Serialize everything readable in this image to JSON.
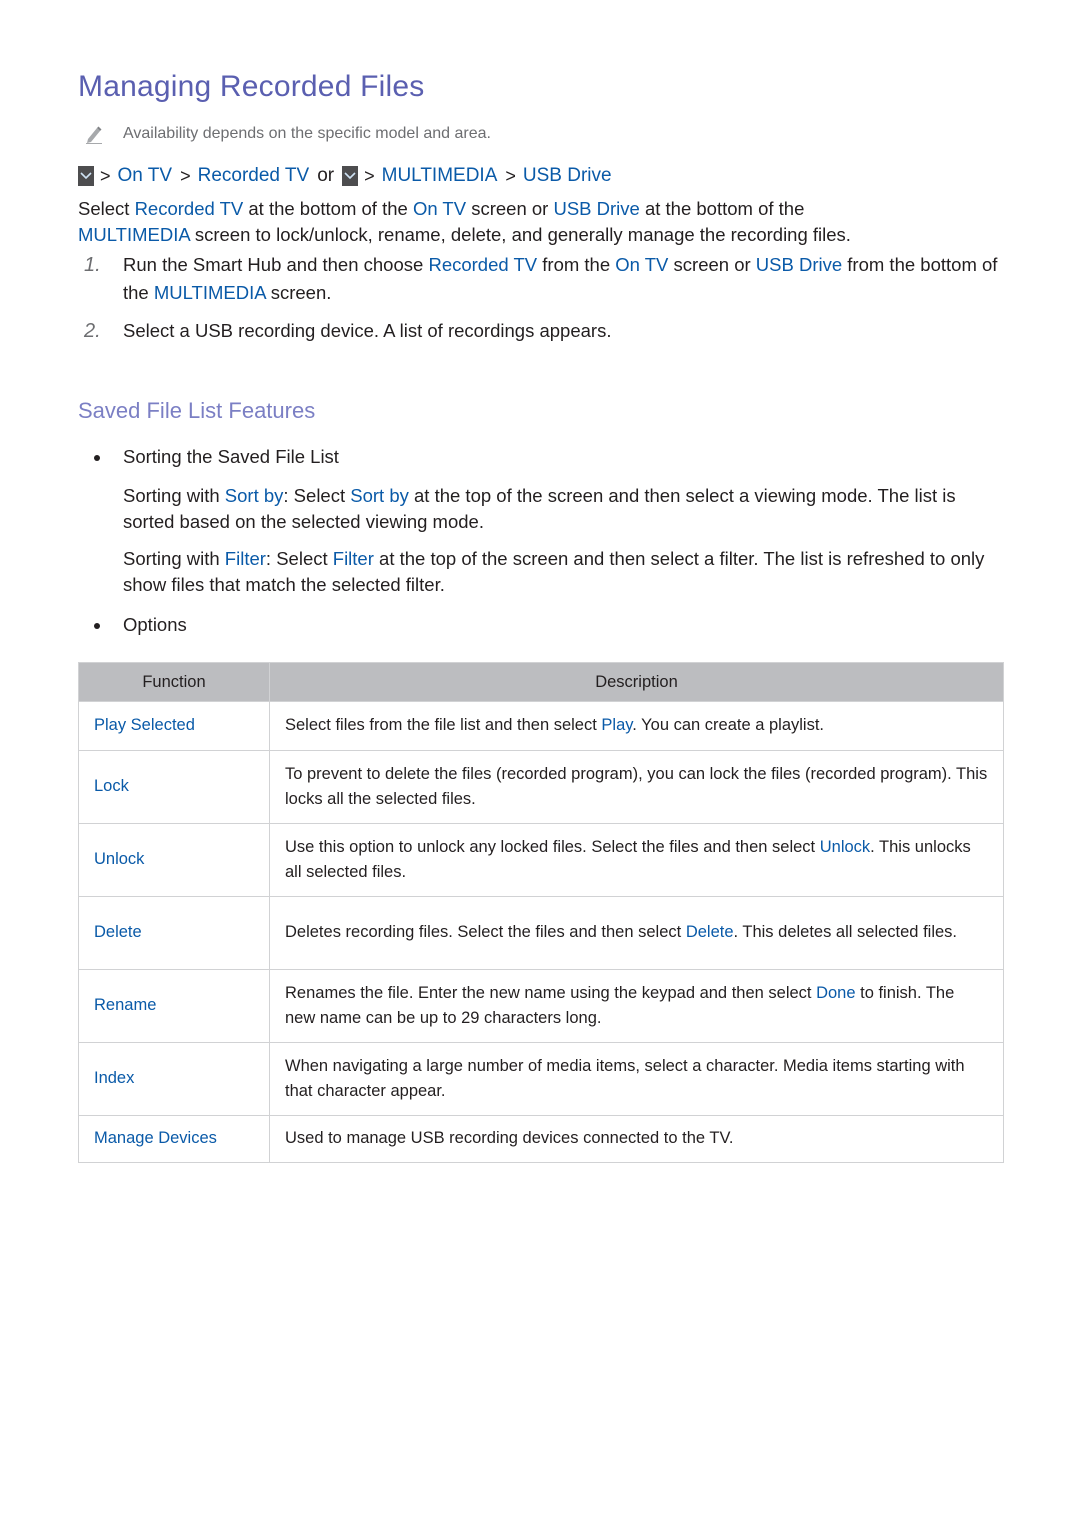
{
  "title": "Managing Recorded Files",
  "note": {
    "icon": "pencil-icon",
    "text": "Availability depends on the specific model and area."
  },
  "breadcrumb": {
    "menu_icon": "menu-chevron-down-icon",
    "separator": ">",
    "path1": [
      "On TV",
      "Recorded TV"
    ],
    "or_text": "or",
    "path2": [
      "MULTIMEDIA",
      "USB Drive"
    ]
  },
  "intro": {
    "parts": [
      "Select ",
      "Recorded TV",
      " at the bottom of the ",
      "On TV",
      " screen or ",
      "USB Drive",
      " at the bottom of the ",
      "MULTIMEDIA",
      " screen to lock/unlock, rename, delete, and generally manage the recording files."
    ]
  },
  "steps": [
    {
      "number": "1.",
      "parts": [
        "Run the Smart Hub and then choose ",
        "Recorded TV",
        " from the ",
        "On TV",
        " screen or ",
        "USB Drive",
        " from the bottom of the ",
        "MULTIMEDIA",
        " screen."
      ]
    },
    {
      "number": "2.",
      "text": "Select a USB recording device. A list of recordings appears."
    }
  ],
  "section": {
    "title": "Saved File List Features",
    "bullets": [
      {
        "label": "Sorting the Saved File List",
        "paragraphs": [
          {
            "parts": [
              "Sorting with ",
              "Sort by",
              ": Select ",
              "Sort by",
              " at the top of the screen and then select a viewing mode. The list is sorted based on the selected viewing mode."
            ]
          },
          {
            "parts": [
              "Sorting with ",
              "Filter",
              ": Select ",
              "Filter",
              " at the top of the screen and then select a filter. The list is refreshed to only show files that match the selected filter."
            ]
          }
        ]
      },
      {
        "label": "Options"
      }
    ]
  },
  "table": {
    "headers": [
      "Function",
      "Description"
    ],
    "rows": [
      {
        "function": "Play Selected",
        "parts": [
          "Select files from the file list and then select ",
          "Play",
          ". You can create a playlist."
        ]
      },
      {
        "function": "Lock",
        "parts": [
          "To prevent to delete the files (recorded program), you can lock the files (recorded program). This locks all the selected files."
        ]
      },
      {
        "function": "Unlock",
        "parts": [
          "Use this option to unlock any locked files. Select the files and then select ",
          "Unlock",
          ". This unlocks all selected files."
        ]
      },
      {
        "function": "Delete",
        "parts": [
          "Deletes recording files. Select the files and then select ",
          "Delete",
          ". This deletes all selected files."
        ]
      },
      {
        "function": "Rename",
        "parts": [
          "Renames the file. Enter the new name using the keypad and then select ",
          "Done",
          " to finish. The new name can be up to 29 characters long."
        ]
      },
      {
        "function": "Index",
        "parts": [
          "When navigating a large number of media items, select a character. Media items starting with that character appear."
        ]
      },
      {
        "function": "Manage Devices",
        "parts": [
          "Used to manage USB recording devices connected to the TV."
        ]
      }
    ]
  },
  "colors": {
    "title": "#5a5fb0",
    "subtitle": "#7b7fc4",
    "link": "#0a5aa8",
    "table_header_bg": "#bcbdc0",
    "text": "#231f20",
    "note_text": "#6d6e71"
  }
}
